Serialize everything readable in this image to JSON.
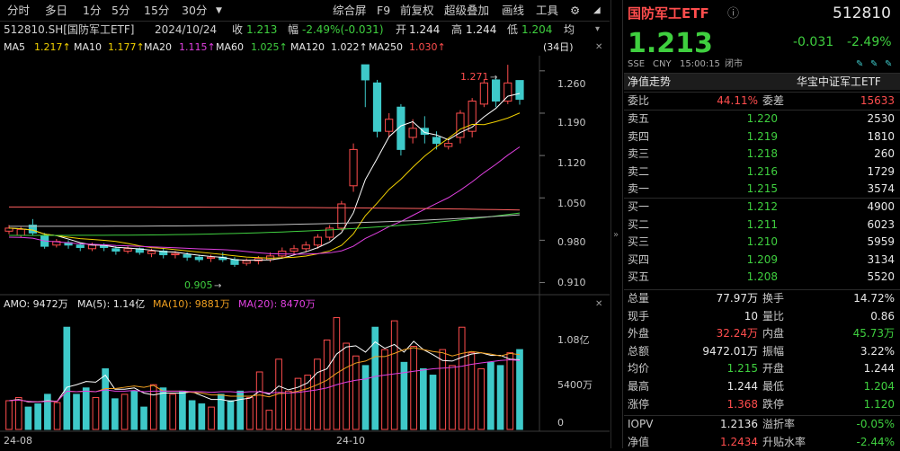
{
  "toolbar": {
    "periods": [
      "分时",
      "多日",
      "1分",
      "5分",
      "15分",
      "30分"
    ],
    "tools": [
      "综合屏",
      "F9",
      "前复权",
      "超级叠加",
      "画线",
      "工具"
    ]
  },
  "info": {
    "code": "512810.SH[国防军工ETF]",
    "date": "2024/10/24",
    "close_label": "收",
    "close": "1.213",
    "change_label": "幅",
    "change": "-2.49%(-0.031)",
    "open_label": "开",
    "open": "1.244",
    "high_label": "高",
    "high": "1.244",
    "low_label": "低",
    "low": "1.204",
    "avg_label": "均"
  },
  "ma": {
    "ma5_label": "MA5",
    "ma5": "1.217↑",
    "ma10_label": "MA10",
    "ma10": "1.177↑",
    "ma20_label": "MA20",
    "ma20": "1.115↑",
    "ma60_label": "MA60",
    "ma60": "1.025↑",
    "ma120_label": "MA120",
    "ma120": "1.022↑",
    "ma250_label": "MA250",
    "ma250": "1.030↑",
    "days": "(34日)"
  },
  "amo": {
    "label": "AMO: 9472万",
    "ma5": "MA(5): 1.14亿",
    "ma10": "MA(10): 9881万",
    "ma20": "MA(20): 8470万"
  },
  "price_axis": [
    "1.260",
    "1.190",
    "1.120",
    "1.050",
    "0.980",
    "0.910"
  ],
  "vol_axis": [
    "1.08亿",
    "5400万",
    "0"
  ],
  "date_axis": [
    "24-08",
    "24-10"
  ],
  "annotations": {
    "high": "1.271",
    "low": "0.905"
  },
  "colors": {
    "up": "#ff4d4d",
    "down": "#3ec9c9",
    "ma5": "#ffffff",
    "ma10": "#f0d000",
    "ma20": "#e040e0",
    "ma60": "#40d040",
    "ma120": "#c0c0c0",
    "ma250": "#ff6060"
  },
  "header": {
    "name": "国防军工ETF",
    "code": "512810",
    "price": "1.213",
    "change": "-0.031",
    "pct": "-2.49%",
    "exch": "SSE",
    "cur": "CNY",
    "time": "15:00:15",
    "status": "闭市"
  },
  "nav": {
    "left": "净值走势",
    "right": "华宝中证军工ETF"
  },
  "weibi": {
    "label": "委比",
    "value": "44.11%",
    "diff_label": "委差",
    "diff": "15633"
  },
  "asks": [
    {
      "label": "卖五",
      "price": "1.220",
      "vol": "2530"
    },
    {
      "label": "卖四",
      "price": "1.219",
      "vol": "1810"
    },
    {
      "label": "卖三",
      "price": "1.218",
      "vol": "260"
    },
    {
      "label": "卖二",
      "price": "1.216",
      "vol": "1729"
    },
    {
      "label": "卖一",
      "price": "1.215",
      "vol": "3574"
    }
  ],
  "bids": [
    {
      "label": "买一",
      "price": "1.212",
      "vol": "4900"
    },
    {
      "label": "买二",
      "price": "1.211",
      "vol": "6023"
    },
    {
      "label": "买三",
      "price": "1.210",
      "vol": "5959"
    },
    {
      "label": "买四",
      "price": "1.209",
      "vol": "3134"
    },
    {
      "label": "买五",
      "price": "1.208",
      "vol": "5520"
    }
  ],
  "stats": [
    {
      "l1": "总量",
      "v1": "77.97万",
      "l2": "换手",
      "v2": "14.72%",
      "c1": "white",
      "c2": "white"
    },
    {
      "l1": "现手",
      "v1": "10",
      "l2": "量比",
      "v2": "0.86",
      "c1": "white",
      "c2": "white"
    },
    {
      "l1": "外盘",
      "v1": "32.24万",
      "l2": "内盘",
      "v2": "45.73万",
      "c1": "red",
      "c2": "green"
    },
    {
      "l1": "总额",
      "v1": "9472.01万",
      "l2": "振幅",
      "v2": "3.22%",
      "c1": "white",
      "c2": "white"
    },
    {
      "l1": "均价",
      "v1": "1.215",
      "l2": "开盘",
      "v2": "1.244",
      "c1": "green",
      "c2": "white"
    },
    {
      "l1": "最高",
      "v1": "1.244",
      "l2": "最低",
      "v2": "1.204",
      "c1": "white",
      "c2": "green"
    },
    {
      "l1": "涨停",
      "v1": "1.368",
      "l2": "跌停",
      "v2": "1.120",
      "c1": "red",
      "c2": "green"
    }
  ],
  "iopv": [
    {
      "l1": "IOPV",
      "v1": "1.2136",
      "l2": "溢折率",
      "v2": "-0.05%",
      "c1": "white",
      "c2": "green"
    },
    {
      "l1": "净值",
      "v1": "1.2434",
      "l2": "升贴水率",
      "v2": "-2.44%",
      "c1": "red",
      "c2": "green"
    }
  ],
  "chart_data": {
    "type": "candlestick",
    "price_range": [
      0.89,
      1.285
    ],
    "candles": [
      [
        0.995,
        1.0,
        0.99,
        1.005
      ],
      [
        0.988,
        0.998,
        0.984,
        1.002
      ],
      [
        1.005,
        0.992,
        0.988,
        1.015
      ],
      [
        0.988,
        0.97,
        0.966,
        0.992
      ],
      [
        0.972,
        0.978,
        0.968,
        0.982
      ],
      [
        0.976,
        0.972,
        0.966,
        0.98
      ],
      [
        0.972,
        0.968,
        0.962,
        0.976
      ],
      [
        0.966,
        0.972,
        0.962,
        0.976
      ],
      [
        0.972,
        0.968,
        0.962,
        0.975
      ],
      [
        0.966,
        0.962,
        0.956,
        0.97
      ],
      [
        0.962,
        0.966,
        0.958,
        0.97
      ],
      [
        0.966,
        0.96,
        0.956,
        0.968
      ],
      [
        0.958,
        0.962,
        0.952,
        0.966
      ],
      [
        0.962,
        0.956,
        0.95,
        0.966
      ],
      [
        0.956,
        0.958,
        0.95,
        0.962
      ],
      [
        0.956,
        0.952,
        0.946,
        0.96
      ],
      [
        0.952,
        0.948,
        0.944,
        0.956
      ],
      [
        0.95,
        0.952,
        0.944,
        0.956
      ],
      [
        0.952,
        0.948,
        0.944,
        0.96
      ],
      [
        0.948,
        0.94,
        0.936,
        0.952
      ],
      [
        0.942,
        0.946,
        0.938,
        0.95
      ],
      [
        0.946,
        0.95,
        0.94,
        0.954
      ],
      [
        0.948,
        0.954,
        0.944,
        0.96
      ],
      [
        0.954,
        0.962,
        0.95,
        0.968
      ],
      [
        0.962,
        0.966,
        0.956,
        0.972
      ],
      [
        0.966,
        0.972,
        0.96,
        0.978
      ],
      [
        0.972,
        0.985,
        0.966,
        0.99
      ],
      [
        0.985,
        1.0,
        0.98,
        1.005
      ],
      [
        1.0,
        1.04,
        0.996,
        1.045
      ],
      [
        1.07,
        1.13,
        1.06,
        1.14
      ],
      [
        1.27,
        1.245,
        1.2,
        1.27
      ],
      [
        1.24,
        1.16,
        1.15,
        1.245
      ],
      [
        1.16,
        1.18,
        1.15,
        1.19
      ],
      [
        1.2,
        1.13,
        1.12,
        1.205
      ],
      [
        1.15,
        1.165,
        1.14,
        1.18
      ],
      [
        1.165,
        1.155,
        1.14,
        1.185
      ],
      [
        1.15,
        1.14,
        1.13,
        1.16
      ],
      [
        1.135,
        1.14,
        1.13,
        1.145
      ],
      [
        1.15,
        1.19,
        1.14,
        1.195
      ],
      [
        1.16,
        1.21,
        1.15,
        1.215
      ],
      [
        1.205,
        1.24,
        1.2,
        1.245
      ],
      [
        1.245,
        1.21,
        1.2,
        1.25
      ],
      [
        1.21,
        1.24,
        1.205,
        1.27
      ],
      [
        1.244,
        1.213,
        1.204,
        1.244
      ]
    ],
    "volume_range": [
      0,
      1.8
    ],
    "volumes": [
      0.45,
      0.5,
      0.35,
      0.4,
      0.55,
      0.42,
      1.6,
      0.55,
      0.65,
      0.5,
      0.95,
      0.48,
      0.55,
      0.6,
      0.35,
      0.7,
      0.65,
      0.55,
      0.6,
      0.45,
      0.4,
      0.35,
      0.55,
      0.45,
      0.6,
      0.5,
      0.9,
      0.3,
      1.1,
      0.6,
      0.8,
      0.85,
      1.1,
      1.4,
      1.75,
      1.35,
      1.15,
      1.0,
      1.6,
      1.25,
      1.7,
      1.05,
      1.3,
      0.95,
      0.85,
      1.25,
      1.0,
      1.6,
      1.2,
      0.95,
      1.05,
      1.0,
      1.2,
      1.25
    ],
    "volume_series": [
      {
        "name": "MA(5)",
        "values": [
          0.45,
          0.47,
          0.43,
          0.43,
          0.45,
          0.44,
          0.66,
          0.7,
          0.75,
          0.74,
          0.85,
          0.63,
          0.63,
          0.65,
          0.57,
          0.54,
          0.57,
          0.57,
          0.57,
          0.59,
          0.53,
          0.47,
          0.47,
          0.44,
          0.47,
          0.49,
          0.6,
          0.55,
          0.68,
          0.62,
          0.66,
          0.73,
          0.89,
          0.95,
          1.18,
          1.29,
          1.31,
          1.21,
          1.37,
          1.27,
          1.33,
          1.21,
          1.38,
          1.25,
          1.17,
          1.08,
          1.07,
          1.13,
          1.18,
          1.2,
          1.16,
          1.16,
          1.1,
          1.09
        ]
      },
      {
        "name": "MA(10)",
        "values": [
          0.45,
          0.46,
          0.44,
          0.43,
          0.44,
          0.44,
          0.6,
          0.59,
          0.6,
          0.59,
          0.64,
          0.64,
          0.66,
          0.68,
          0.66,
          0.69,
          0.6,
          0.6,
          0.6,
          0.58,
          0.57,
          0.54,
          0.54,
          0.52,
          0.52,
          0.52,
          0.54,
          0.51,
          0.56,
          0.57,
          0.6,
          0.64,
          0.7,
          0.77,
          0.88,
          0.97,
          1.04,
          1.07,
          1.14,
          1.14,
          1.19,
          1.25,
          1.28,
          1.25,
          1.22,
          1.2,
          1.15,
          1.19,
          1.22,
          1.2,
          1.18,
          1.15,
          1.19,
          1.17
        ]
      },
      {
        "name": "MA(20)",
        "values": [
          0.45,
          0.46,
          0.44,
          0.43,
          0.44,
          0.44,
          0.6,
          0.59,
          0.6,
          0.59,
          0.62,
          0.6,
          0.6,
          0.61,
          0.59,
          0.6,
          0.6,
          0.6,
          0.6,
          0.59,
          0.59,
          0.58,
          0.59,
          0.59,
          0.58,
          0.59,
          0.59,
          0.57,
          0.58,
          0.57,
          0.58,
          0.6,
          0.62,
          0.65,
          0.7,
          0.74,
          0.77,
          0.79,
          0.83,
          0.85,
          0.87,
          0.89,
          0.91,
          0.93,
          0.95,
          0.96,
          0.97,
          0.99,
          1.02,
          1.04,
          1.06,
          1.08,
          1.09,
          1.08
        ]
      }
    ]
  }
}
